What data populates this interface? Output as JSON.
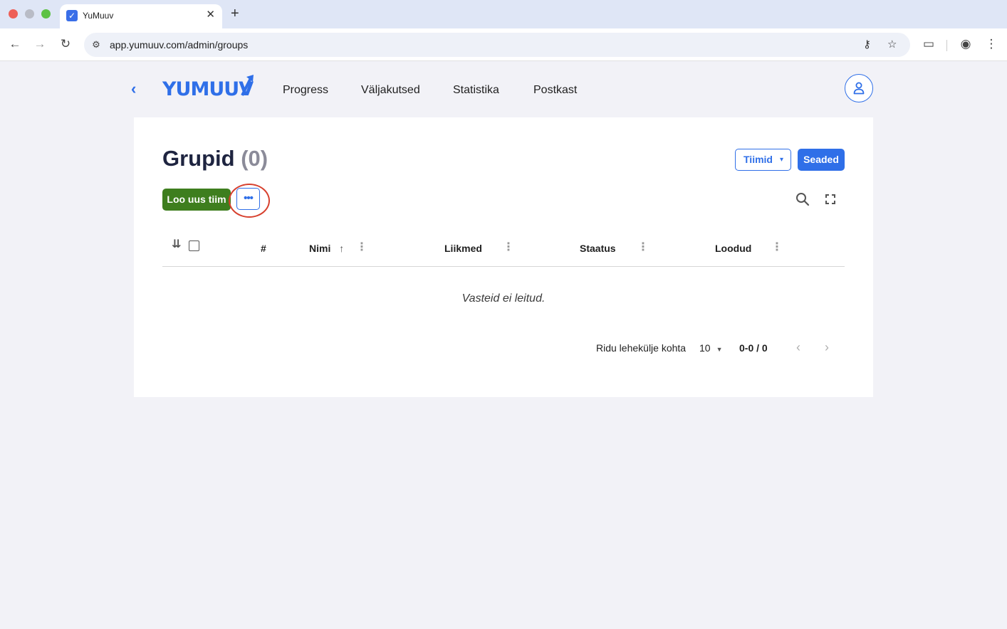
{
  "browser": {
    "tab_title": "YuMuuv",
    "tab_favicon": "✓",
    "url": "app.yumuuv.com/admin/groups"
  },
  "app": {
    "logo_text": "YUMUUV",
    "nav": [
      "Progress",
      "Väljakutsed",
      "Statistika",
      "Postkast"
    ],
    "accent_color": "#2f6fe8"
  },
  "page": {
    "title": "Grupid",
    "count": "(0)",
    "teams_dropdown": "Tiimid",
    "settings_button": "Seaded",
    "create_button": "Loo uus tiim",
    "more_button": "•••"
  },
  "table": {
    "columns": {
      "index": "#",
      "name": "Nimi",
      "members": "Liikmed",
      "status": "Staatus",
      "created": "Loodud"
    },
    "empty_message": "Vasteid ei leitud."
  },
  "pagination": {
    "rows_label": "Ridu lehekülje kohta",
    "rows_value": "10",
    "range": "0-0 / 0"
  }
}
